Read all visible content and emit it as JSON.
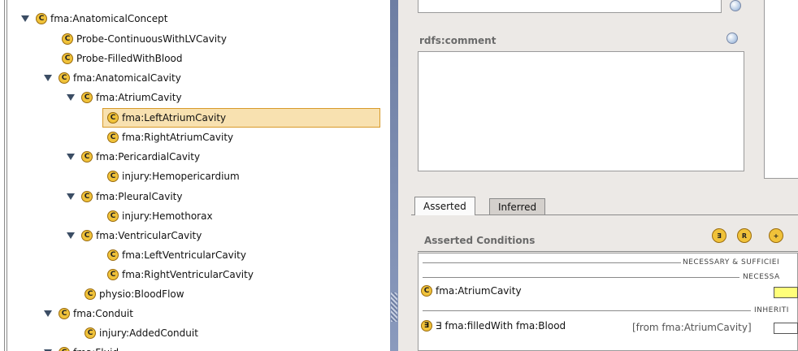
{
  "class_icon_letter": "C",
  "tree": {
    "rows": [
      {
        "label": "fma:AnatomicalConcept"
      },
      {
        "label": "Probe-ContinuousWithLVCavity"
      },
      {
        "label": "Probe-FilledWithBlood"
      },
      {
        "label": "fma:AnatomicalCavity"
      },
      {
        "label": "fma:AtriumCavity"
      },
      {
        "label": "fma:LeftAtriumCavity"
      },
      {
        "label": "fma:RightAtriumCavity"
      },
      {
        "label": "fma:PericardialCavity"
      },
      {
        "label": "injury:Hemopericardium"
      },
      {
        "label": "fma:PleuralCavity"
      },
      {
        "label": "injury:Hemothorax"
      },
      {
        "label": "fma:VentricularCavity"
      },
      {
        "label": "fma:LeftVentricularCavity"
      },
      {
        "label": "fma:RightVentricularCavity"
      },
      {
        "label": "physio:BloodFlow"
      },
      {
        "label": "fma:Conduit"
      },
      {
        "label": "injury:AddedConduit"
      },
      {
        "label": "fma:Fluid"
      }
    ],
    "selected_label": "fma:LeftAtriumCavity"
  },
  "comment": {
    "label": "rdfs:comment"
  },
  "tabs": [
    {
      "label": "Asserted",
      "active": true
    },
    {
      "label": "Inferred",
      "active": false
    }
  ],
  "conditions": {
    "title": "Asserted Conditions",
    "tool_icons": [
      "create-restriction-icon",
      "create-restriction-r-icon",
      "add-class-icon"
    ],
    "header_necessary_sufficient": "NECESSARY & SUFFICIEI",
    "header_necessary": "NECESSA",
    "header_inherited": "INHERITI",
    "row1": {
      "icon_letter": "C",
      "label": "fma:AtriumCavity"
    },
    "row2": {
      "icon_letter": "∃",
      "label": "∃ fma:filledWith fma:Blood",
      "source": "[from fma:AtriumCavity]"
    }
  },
  "colors": {
    "class_icon": "#f0c23a",
    "selection_fill": "#f8e1b0",
    "selection_border": "#d89a2a",
    "splitter": "#7787aa",
    "panel_bg": "#ece9e6"
  }
}
